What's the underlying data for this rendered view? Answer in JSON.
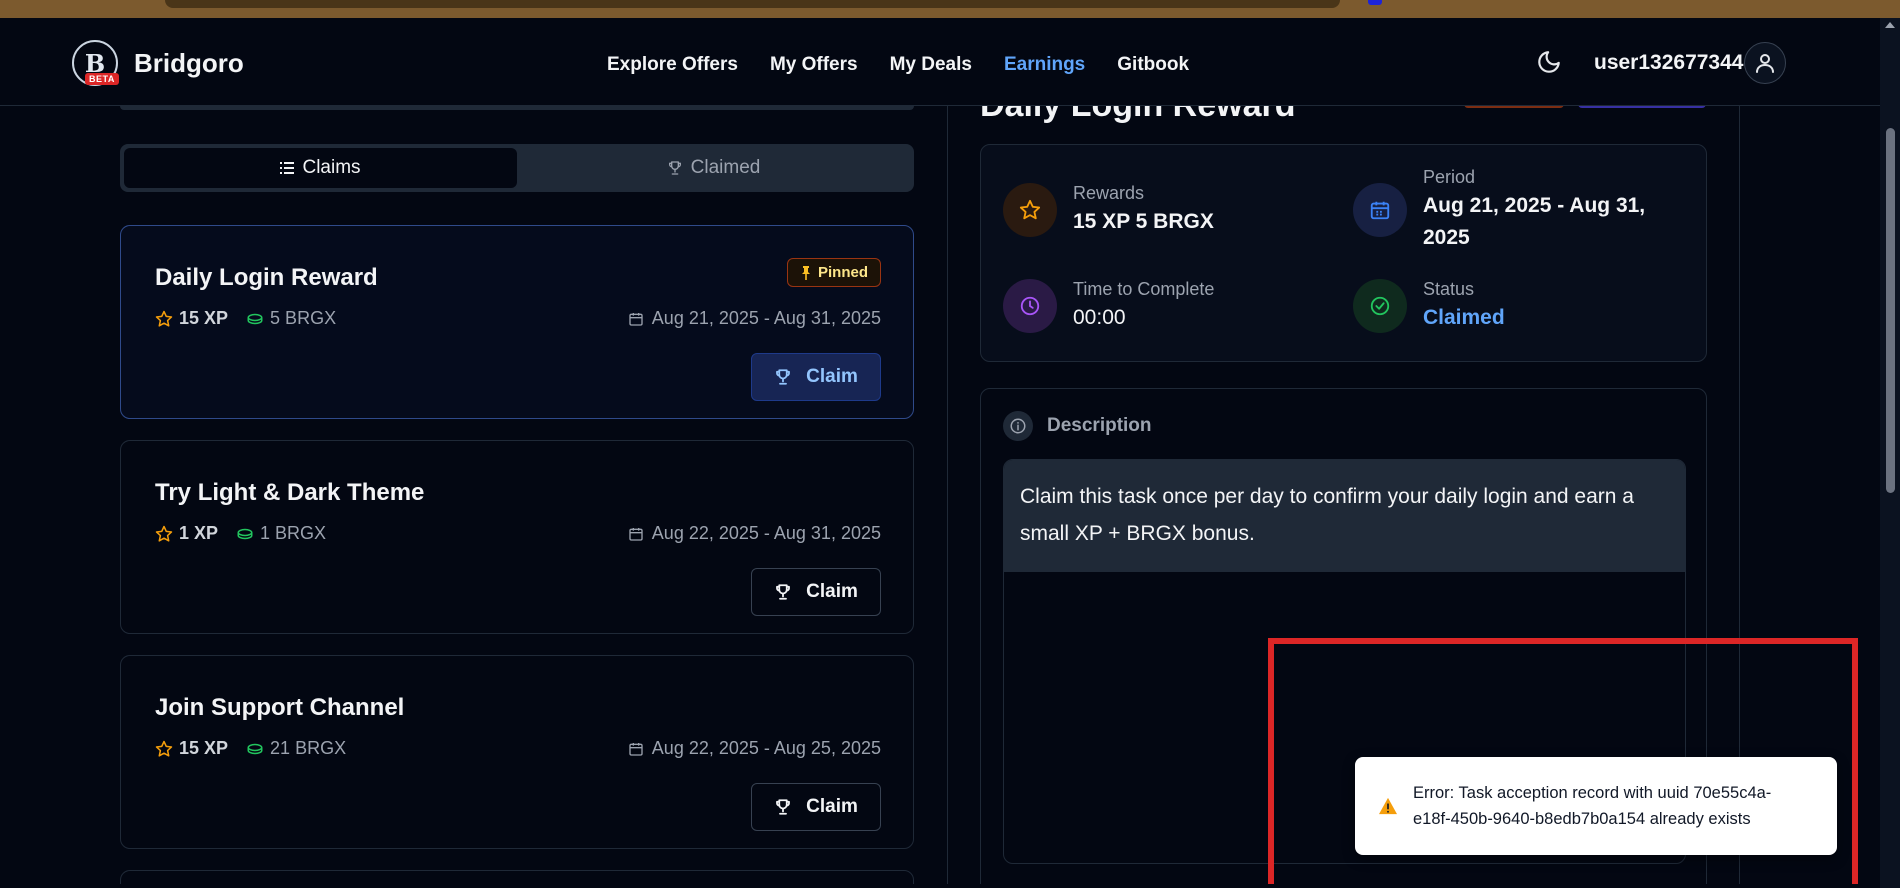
{
  "header": {
    "logo_text": "B",
    "beta_label": "BETA",
    "brand": "Bridgoro",
    "nav": [
      {
        "label": "Explore Offers",
        "active": false
      },
      {
        "label": "My Offers",
        "active": false
      },
      {
        "label": "My Deals",
        "active": false
      },
      {
        "label": "Earnings",
        "active": true
      },
      {
        "label": "Gitbook",
        "active": false
      }
    ],
    "theme_icon": "moon-icon",
    "username": "user132677344",
    "avatar_icon": "user-icon"
  },
  "tabs": {
    "claims_label": "Claims",
    "claimed_label": "Claimed",
    "active": "Claims"
  },
  "tasks": [
    {
      "title": "Daily Login Reward",
      "xp": "15 XP",
      "brgx": "5 BRGX",
      "date": "Aug 21, 2025 - Aug 31, 2025",
      "claim_label": "Claim",
      "pinned_label": "Pinned",
      "selected": true
    },
    {
      "title": "Try Light & Dark Theme",
      "xp": "1 XP",
      "brgx": "1 BRGX",
      "date": "Aug 22, 2025 - Aug 31, 2025",
      "claim_label": "Claim"
    },
    {
      "title": "Join Support Channel",
      "xp": "15 XP",
      "brgx": "21 BRGX",
      "date": "Aug 22, 2025 - Aug 25, 2025",
      "claim_label": "Claim"
    }
  ],
  "detail": {
    "title": "Daily Login Reward",
    "rewards_label": "Rewards",
    "rewards_value": "15 XP  5 BRGX",
    "period_label": "Period",
    "period_value": "Aug 21, 2025 - Aug 31, 2025",
    "time_label": "Time to Complete",
    "time_value": "00:00",
    "status_label": "Status",
    "status_value": "Claimed",
    "description_label": "Description",
    "description_text": "Claim this task once per day to confirm your daily login and earn a small XP + BRGX bonus."
  },
  "toast": {
    "icon": "warning-icon",
    "message": "Error: Task acception record with uuid 70e55c4a-e18f-450b-9640-b8edb7b0a154 already exists"
  },
  "colors": {
    "accent": "#60a5fa",
    "background": "#030712",
    "error_highlight": "#dc2626"
  }
}
